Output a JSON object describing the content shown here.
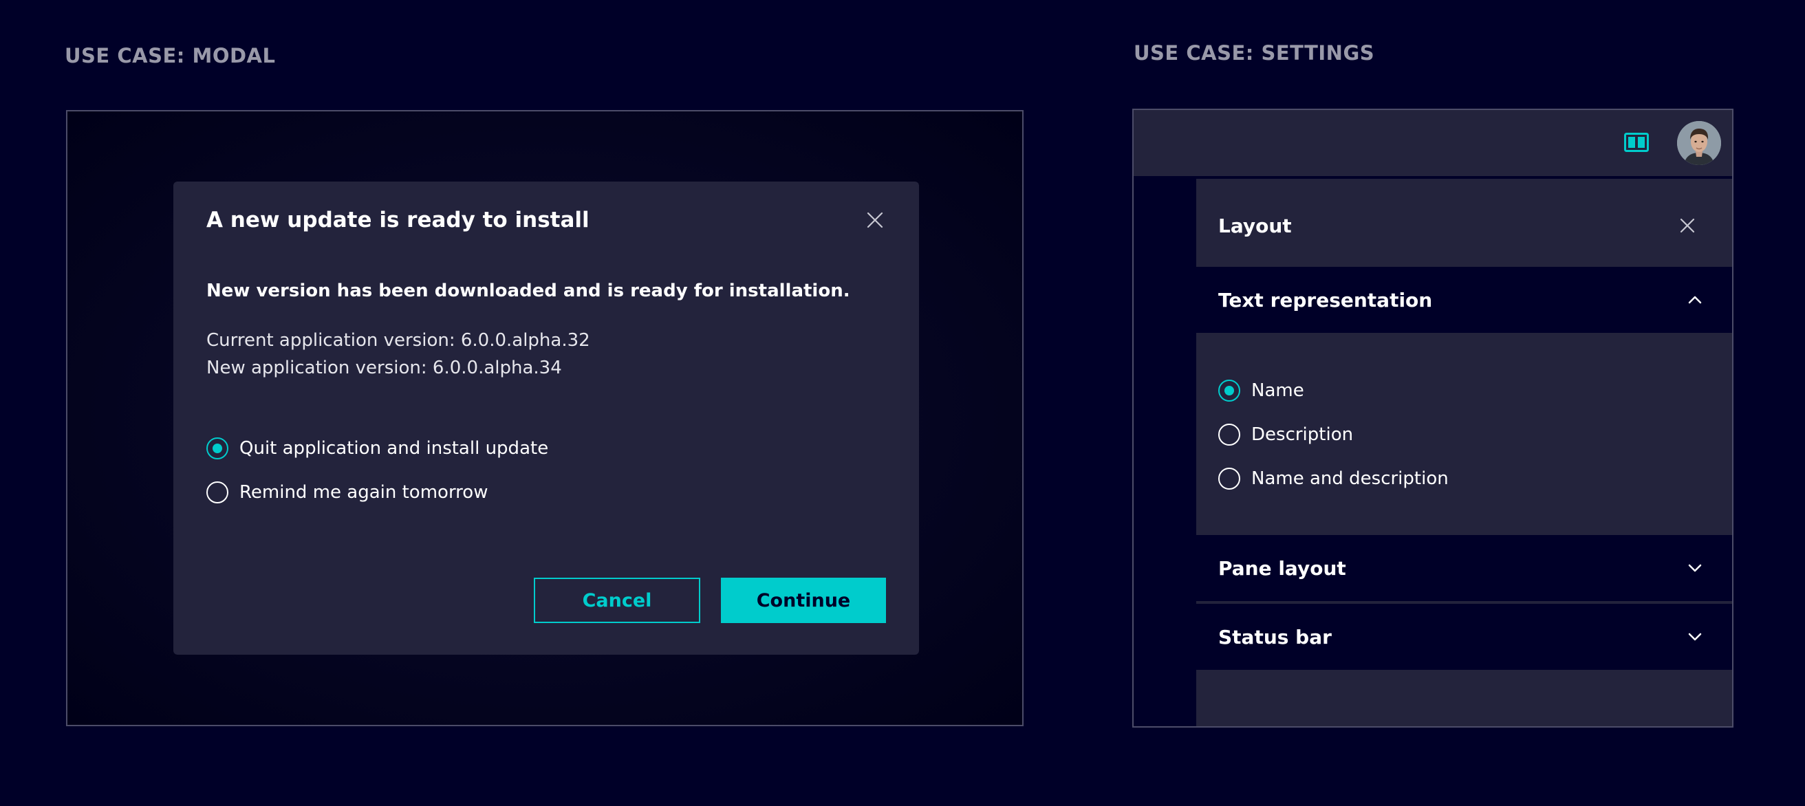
{
  "headings": {
    "modal": "USE CASE: MODAL",
    "settings": "USE CASE: SETTINGS"
  },
  "modal": {
    "title": "A new update is ready to install",
    "lead": "New version has been downloaded and is ready for installation.",
    "current_version": "Current application version: 6.0.0.alpha.32",
    "new_version": "New application version: 6.0.0.alpha.34",
    "options": [
      {
        "label": "Quit application and install update",
        "selected": true
      },
      {
        "label": "Remind me again tomorrow",
        "selected": false
      }
    ],
    "cancel_label": "Cancel",
    "continue_label": "Continue"
  },
  "settings": {
    "panel_title": "Layout",
    "sections": [
      {
        "title": "Text representation",
        "expanded": true,
        "options": [
          {
            "label": "Name",
            "selected": true
          },
          {
            "label": "Description",
            "selected": false
          },
          {
            "label": "Name and description",
            "selected": false
          }
        ]
      },
      {
        "title": "Pane layout",
        "expanded": false
      },
      {
        "title": "Status bar",
        "expanded": false
      }
    ]
  },
  "colors": {
    "background": "#000028",
    "surface": "#23233c",
    "accent": "#00cccc",
    "heading_text": "#9999a9",
    "border": "#4c4c68"
  },
  "icons": {
    "close": "close-icon",
    "chevron_up": "chevron-up-icon",
    "chevron_down": "chevron-down-icon",
    "layout_toggle": "layout-columns-icon",
    "avatar": "user-avatar"
  }
}
